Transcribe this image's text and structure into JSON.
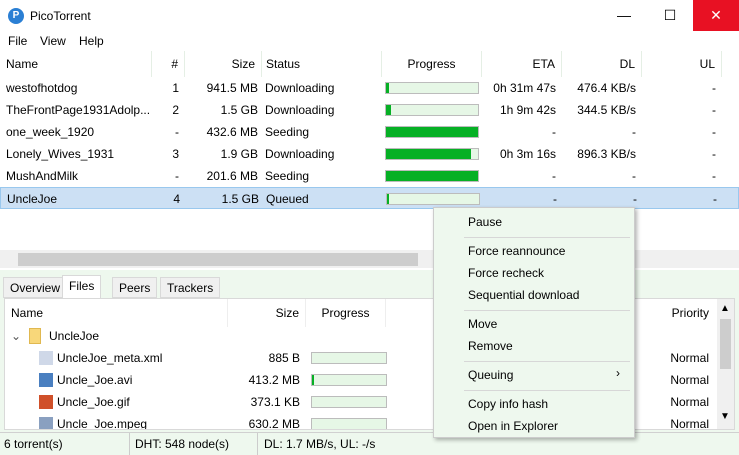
{
  "window": {
    "title": "PicoTorrent",
    "minimize": "—",
    "maximize": "☐",
    "close": "✕"
  },
  "menu": [
    "File",
    "View",
    "Help"
  ],
  "columns": [
    "Name",
    "#",
    "Size",
    "Status",
    "Progress",
    "ETA",
    "DL",
    "UL"
  ],
  "torrents": [
    {
      "name": "westofhotdog",
      "queue": "1",
      "size": "941.5 MB",
      "status": "Downloading",
      "progress": 3,
      "eta": "0h 31m 47s",
      "dl": "476.4 KB/s",
      "ul": "-"
    },
    {
      "name": "TheFrontPage1931Adolp...",
      "queue": "2",
      "size": "1.5 GB",
      "status": "Downloading",
      "progress": 5,
      "eta": "1h 9m 42s",
      "dl": "344.5 KB/s",
      "ul": "-"
    },
    {
      "name": "one_week_1920",
      "queue": "-",
      "size": "432.6 MB",
      "status": "Seeding",
      "progress": 100,
      "eta": "-",
      "dl": "-",
      "ul": "-"
    },
    {
      "name": "Lonely_Wives_1931",
      "queue": "3",
      "size": "1.9 GB",
      "status": "Downloading",
      "progress": 92,
      "eta": "0h 3m 16s",
      "dl": "896.3 KB/s",
      "ul": "-"
    },
    {
      "name": "MushAndMilk",
      "queue": "-",
      "size": "201.6 MB",
      "status": "Seeding",
      "progress": 100,
      "eta": "-",
      "dl": "-",
      "ul": "-"
    },
    {
      "name": "UncleJoe",
      "queue": "4",
      "size": "1.5 GB",
      "status": "Queued",
      "progress": 1,
      "eta": "-",
      "dl": "-",
      "ul": "-"
    }
  ],
  "tabs": [
    "Overview",
    "Files",
    "Peers",
    "Trackers"
  ],
  "files": {
    "columns": [
      "Name",
      "Size",
      "Progress",
      "Priority"
    ],
    "folder": "UncleJoe",
    "items": [
      {
        "name": "UncleJoe_meta.xml",
        "size": "885 B",
        "progress": 0,
        "priority": "Normal"
      },
      {
        "name": "Uncle_Joe.avi",
        "size": "413.2 MB",
        "progress": 3,
        "priority": "Normal"
      },
      {
        "name": "Uncle_Joe.gif",
        "size": "373.1 KB",
        "progress": 0,
        "priority": "Normal"
      },
      {
        "name": "Uncle_Joe.mpeg",
        "size": "630.2 MB",
        "progress": 0,
        "priority": "Normal"
      }
    ]
  },
  "context_menu": [
    "Pause",
    "Force reannounce",
    "Force recheck",
    "Sequential download",
    "Move",
    "Remove",
    "Queuing",
    "Copy info hash",
    "Open in Explorer"
  ],
  "status": {
    "torrents": "6 torrent(s)",
    "dht": "DHT: 548 node(s)",
    "speed": "DL: 1.7 MB/s, UL: -/s"
  },
  "colors": {
    "progress": "#06b025",
    "selection": "#cce0f4",
    "close": "#e81123"
  }
}
